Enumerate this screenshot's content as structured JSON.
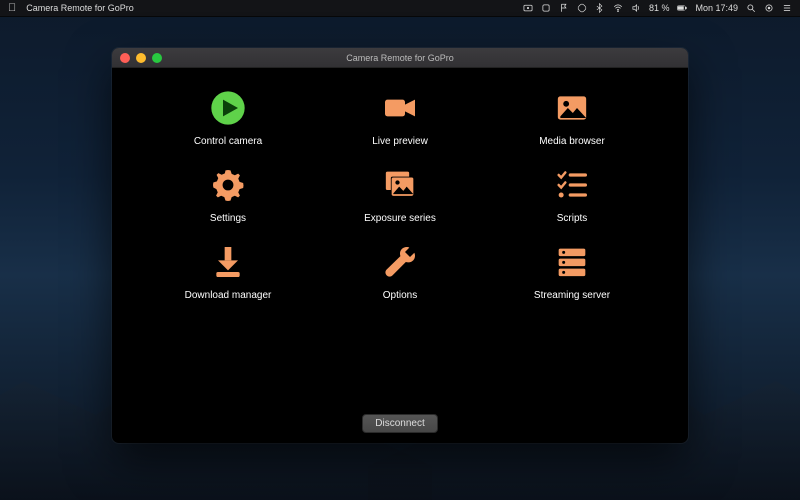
{
  "menubar": {
    "app_name": "Camera Remote for GoPro",
    "battery": "81 %",
    "clock": "Mon 17:49"
  },
  "window": {
    "title": "Camera Remote for GoPro",
    "disconnect_label": "Disconnect"
  },
  "tiles": {
    "control_camera": "Control camera",
    "live_preview": "Live preview",
    "media_browser": "Media browser",
    "settings": "Settings",
    "exposure_series": "Exposure series",
    "scripts": "Scripts",
    "download_manager": "Download manager",
    "options": "Options",
    "streaming_server": "Streaming server"
  },
  "colors": {
    "accent": "#f49b63",
    "play": "#5fd24a"
  }
}
